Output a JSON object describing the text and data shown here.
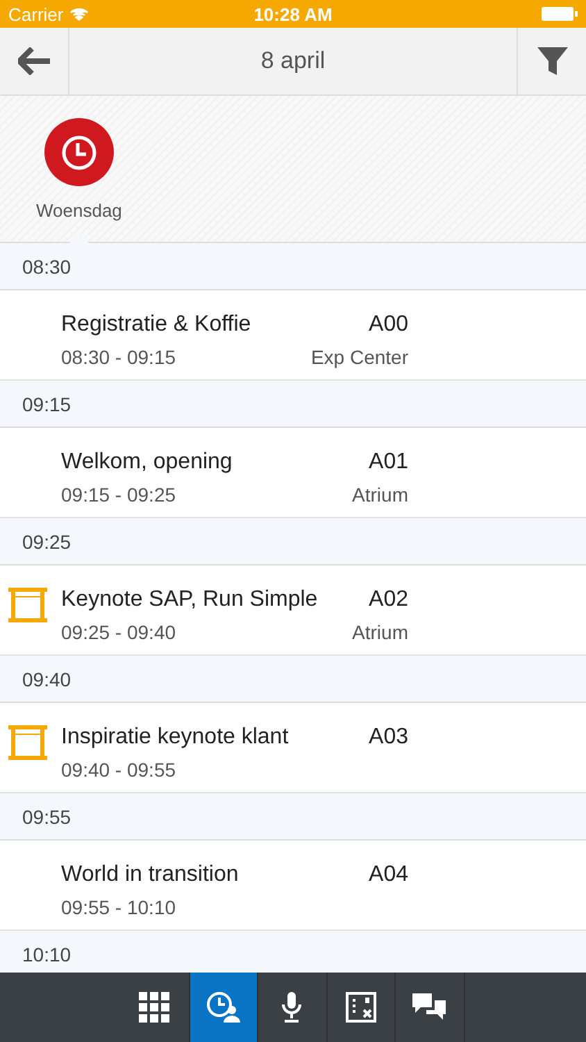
{
  "status_bar": {
    "carrier": "Carrier",
    "time": "10:28 AM"
  },
  "nav": {
    "title": "8 april"
  },
  "days": [
    {
      "label": "Woensdag",
      "selected": true
    }
  ],
  "sections": [
    {
      "time": "08:30",
      "sessions": [
        {
          "kind": "plain",
          "title": "Registratie & Koffie",
          "code": "A00",
          "hours": "08:30 - 09:15",
          "room": "Exp Center"
        }
      ]
    },
    {
      "time": "09:15",
      "sessions": [
        {
          "kind": "plain",
          "title": "Welkom, opening",
          "code": "A01",
          "hours": "09:15 - 09:25",
          "room": "Atrium"
        }
      ]
    },
    {
      "time": "09:25",
      "sessions": [
        {
          "kind": "keynote",
          "title": "Keynote SAP, Run Simple",
          "code": "A02",
          "hours": "09:25 - 09:40",
          "room": "Atrium"
        }
      ]
    },
    {
      "time": "09:40",
      "sessions": [
        {
          "kind": "keynote",
          "title": "Inspiratie keynote klant",
          "code": "A03",
          "hours": "09:40 - 09:55"
        }
      ]
    },
    {
      "time": "09:55",
      "sessions": [
        {
          "kind": "plain",
          "title": "World in transition",
          "code": "A04",
          "hours": "09:55 - 10:10"
        }
      ]
    },
    {
      "time": "10:10"
    }
  ],
  "tabbar": [
    {
      "kind": "grid",
      "selected": false
    },
    {
      "kind": "agenda",
      "selected": true
    },
    {
      "kind": "mic",
      "selected": false
    },
    {
      "kind": "map",
      "selected": false
    },
    {
      "kind": "chat",
      "selected": false
    }
  ]
}
